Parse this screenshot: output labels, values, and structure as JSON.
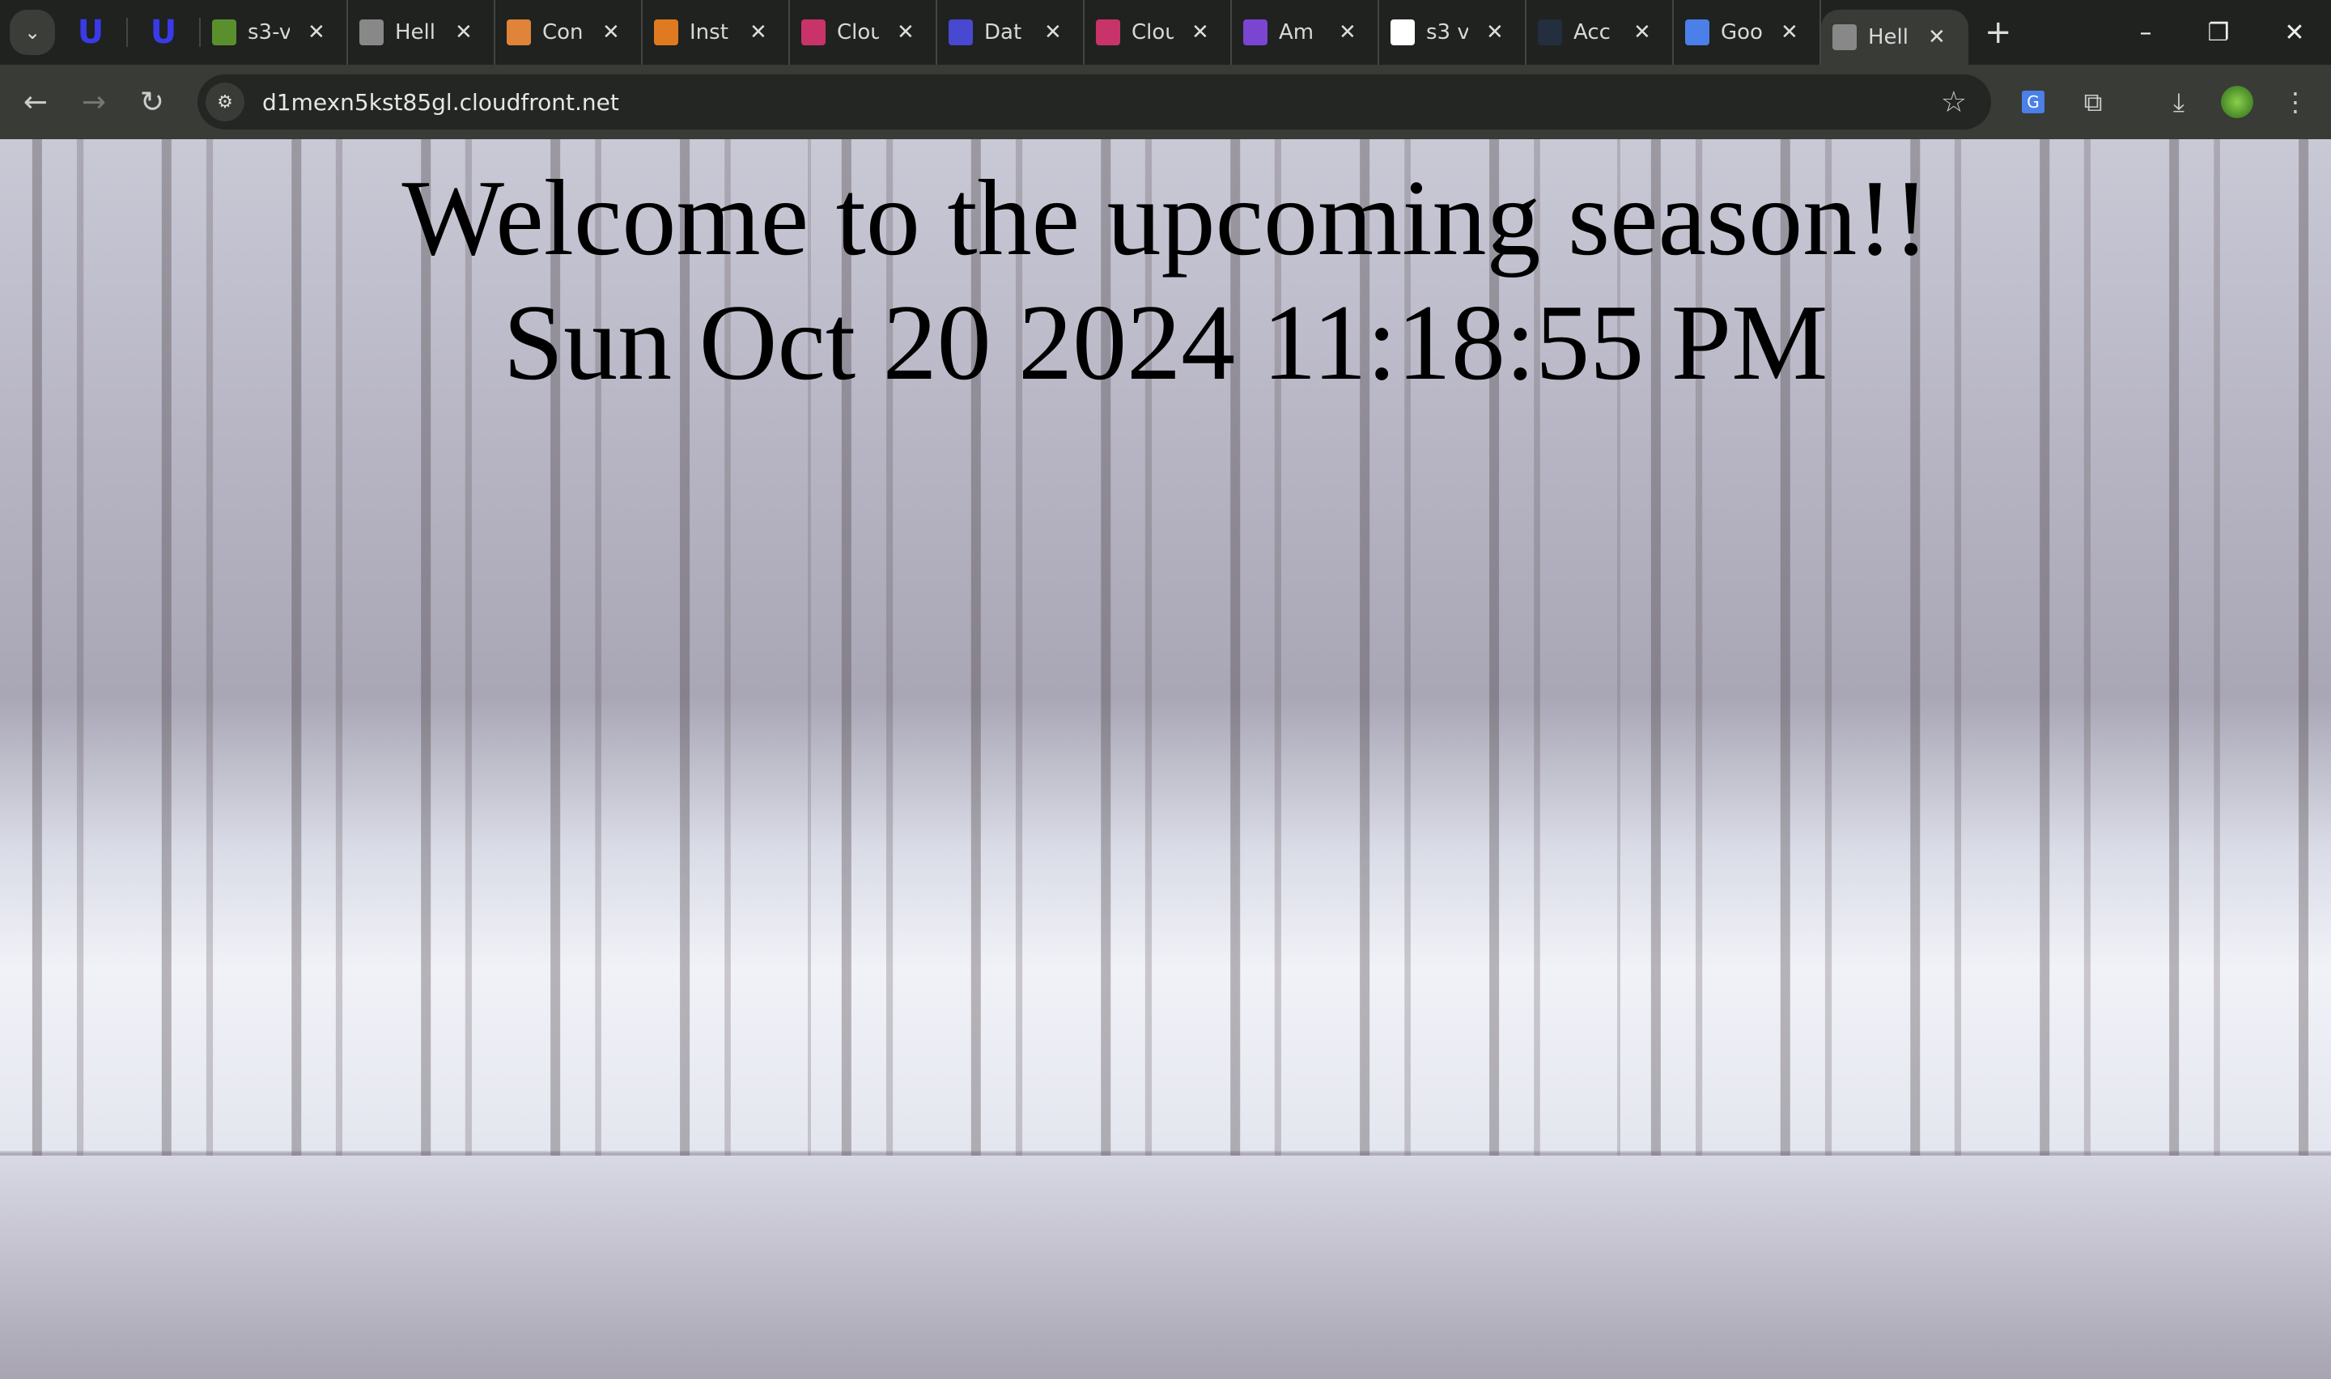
{
  "browser": {
    "tabs": [
      {
        "title": "s3-v",
        "favicon": "s3-bucket-icon",
        "color": "#5a8f2e"
      },
      {
        "title": "Hell",
        "favicon": "globe-icon",
        "color": "#888888"
      },
      {
        "title": "Con",
        "favicon": "aws-box-icon",
        "color": "#e0843a"
      },
      {
        "title": "Inst",
        "favicon": "ec2-icon",
        "color": "#e07a20"
      },
      {
        "title": "Clou",
        "favicon": "cloudwatch-icon",
        "color": "#c8336a"
      },
      {
        "title": "Dat",
        "favicon": "datasync-icon",
        "color": "#4848d0"
      },
      {
        "title": "Clou",
        "favicon": "cloudfront-icon",
        "color": "#c8336a"
      },
      {
        "title": "Am",
        "favicon": "amazon-service-icon",
        "color": "#7a45d0"
      },
      {
        "title": "s3 v",
        "favicon": "google-icon",
        "color": "#ffffff"
      },
      {
        "title": "Acc",
        "favicon": "aws-icon",
        "color": "#232f3e"
      },
      {
        "title": "Goo",
        "favicon": "google-translate-icon",
        "color": "#4a80e8"
      },
      {
        "title": "Hell",
        "favicon": "globe-icon",
        "color": "#888888",
        "active": true
      }
    ],
    "url": "d1mexn5kst85gl.cloudfront.net"
  },
  "page": {
    "heading": "Welcome to the upcoming season!!",
    "datetime": "Sun Oct 20 2024 11:18:55 PM"
  }
}
